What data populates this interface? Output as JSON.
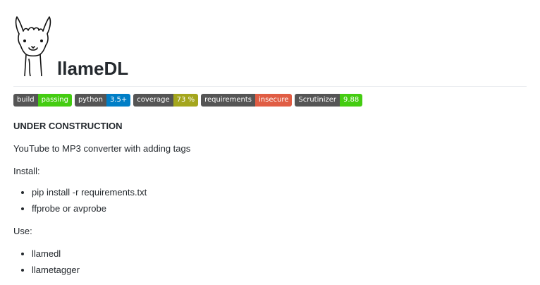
{
  "title": "llameDL",
  "badges": [
    {
      "label": "build",
      "value": "passing",
      "color": "#44cc11"
    },
    {
      "label": "python",
      "value": "3.5+",
      "color": "#007ec6"
    },
    {
      "label": "coverage",
      "value": "73 %",
      "color": "#a4a61d"
    },
    {
      "label": "requirements",
      "value": "insecure",
      "color": "#e05d44"
    },
    {
      "label": "Scrutinizer",
      "value": "9.88",
      "color": "#44cc11"
    }
  ],
  "notice": "UNDER CONSTRUCTION",
  "description": "YouTube to MP3 converter with adding tags",
  "install": {
    "heading": "Install:",
    "items": [
      "pip install -r requirements.txt",
      "ffprobe or avprobe"
    ]
  },
  "use": {
    "heading": "Use:",
    "items": [
      "llamedl",
      "llametagger"
    ]
  }
}
